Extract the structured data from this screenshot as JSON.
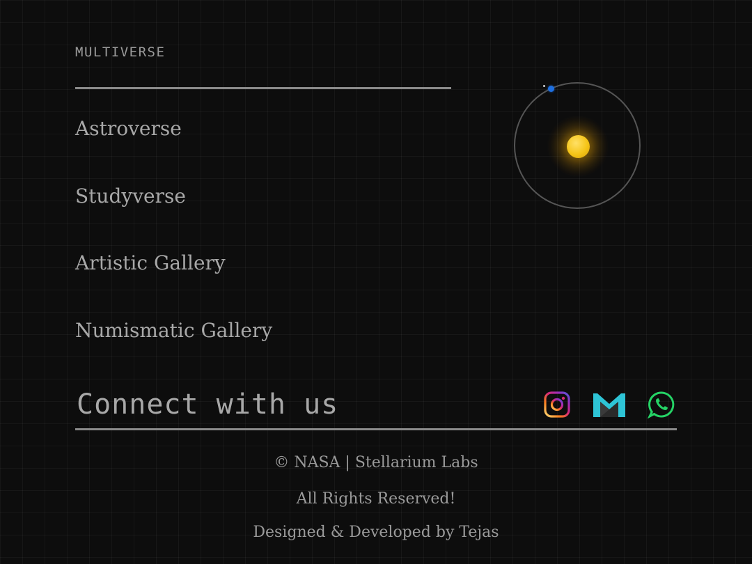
{
  "section": {
    "label": "MULTIVERSE"
  },
  "nav": {
    "items": [
      {
        "label": "Astroverse"
      },
      {
        "label": "Studyverse"
      },
      {
        "label": "Artistic Gallery"
      },
      {
        "label": "Numismatic Gallery"
      }
    ]
  },
  "connect": {
    "title": "Connect with us",
    "icons": [
      "instagram-icon",
      "gmail-icon",
      "whatsapp-icon"
    ]
  },
  "footer": {
    "copyright": "© NASA | Stellarium Labs",
    "rights": "All Rights Reserved!",
    "credit": "Designed & Developed by Tejas"
  },
  "colors": {
    "background": "#0d0d0d",
    "text": "#a8a8a8",
    "sun": "#f5c518",
    "planet": "#1e6fe0",
    "whatsapp": "#25d366",
    "gmail": "#2ec4d6"
  }
}
